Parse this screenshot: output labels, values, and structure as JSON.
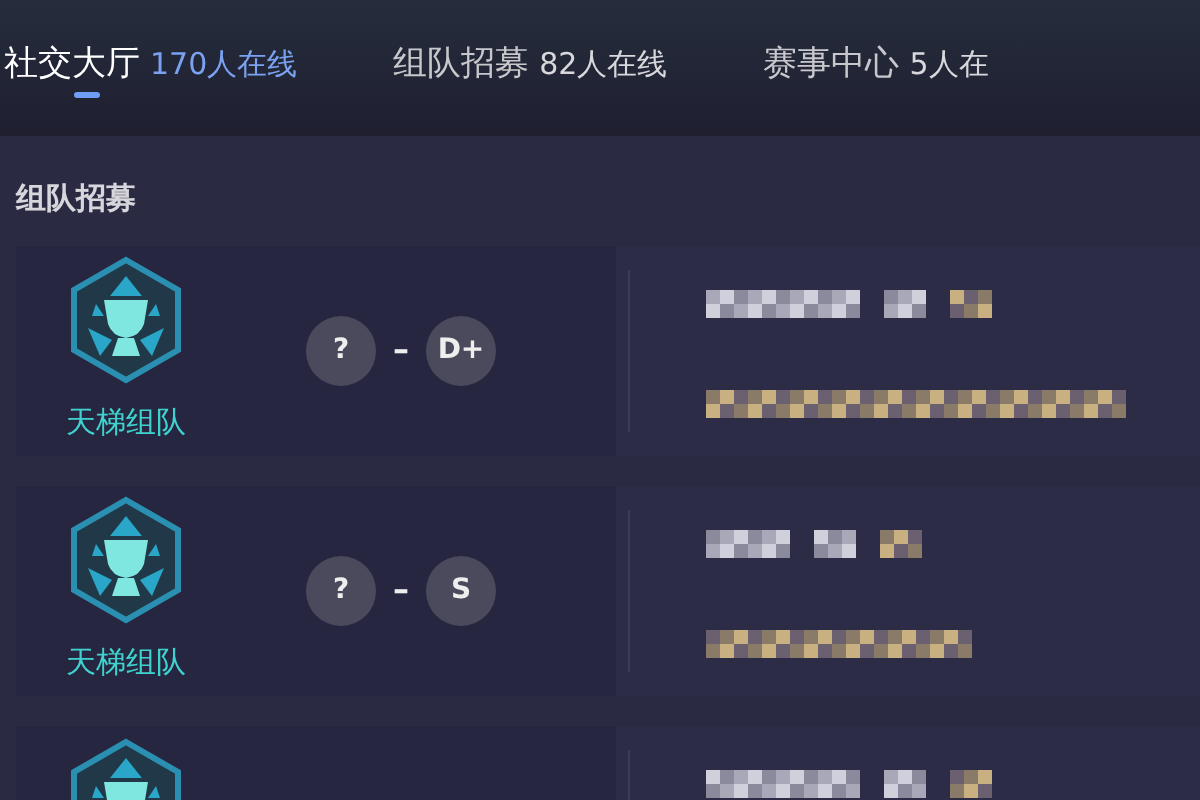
{
  "tabs": [
    {
      "label": "社交大厅",
      "count": "170人在线",
      "selected": true
    },
    {
      "label": "组队招募",
      "count": "82人在线",
      "selected": false
    },
    {
      "label": "赛事中心",
      "count": "5人在",
      "selected": false
    }
  ],
  "section": {
    "title": "组队招募"
  },
  "posts": [
    {
      "kind": "ladder",
      "mode": "天梯组队",
      "rank_from": "?",
      "separator": "–",
      "rank_to": "D+"
    },
    {
      "kind": "ladder",
      "mode": "天梯组队",
      "rank_from": "?",
      "separator": "–",
      "rank_to": "S"
    },
    {
      "kind": "ladder"
    }
  ]
}
